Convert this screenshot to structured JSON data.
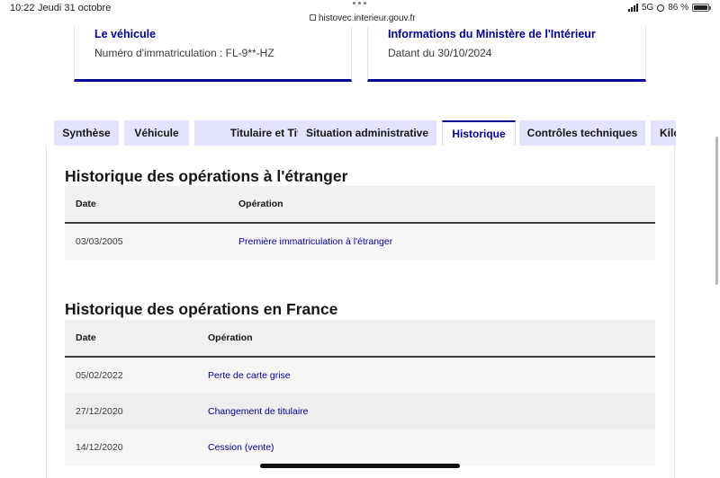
{
  "statusbar": {
    "time": "10:22",
    "date": "Jeudi 31 octobre",
    "url": "histovec.interieur.gouv.fr",
    "network": "5G",
    "battery": "86 %",
    "battery_level": 0.86
  },
  "cards": {
    "vehicle": {
      "title": "Le véhicule",
      "value": "Numéro d'immatriculation : FL-9**-HZ"
    },
    "ministry": {
      "title": "Informations du Ministère de l'Intérieur",
      "value": "Datant du 30/10/2024"
    }
  },
  "tabs": [
    {
      "label": "Synthèse"
    },
    {
      "label": "Véhicule"
    },
    {
      "label": "Titulaire et Titre"
    },
    {
      "label": "Situation administrative"
    },
    {
      "label": "Historique",
      "active": true
    },
    {
      "label": "Contrôles techniques"
    },
    {
      "label": "Kilo"
    }
  ],
  "foreign": {
    "heading": "Historique des opérations à l'étranger",
    "columns": {
      "date": "Date",
      "operation": "Opération"
    },
    "rows": [
      {
        "date": "03/03/2005",
        "operation": "Première immatriculation à l'étranger"
      }
    ]
  },
  "france": {
    "heading": "Historique des opérations en France",
    "columns": {
      "date": "Date",
      "operation": "Opération"
    },
    "rows": [
      {
        "date": "05/02/2022",
        "operation": "Perte de carte grise"
      },
      {
        "date": "27/12/2020",
        "operation": "Changement de titulaire"
      },
      {
        "date": "14/12/2020",
        "operation": "Cession (vente)"
      }
    ]
  },
  "colors": {
    "accent": "#000091",
    "tab_bg": "#e3e3fd",
    "row_alt": "#f6f6f6"
  }
}
